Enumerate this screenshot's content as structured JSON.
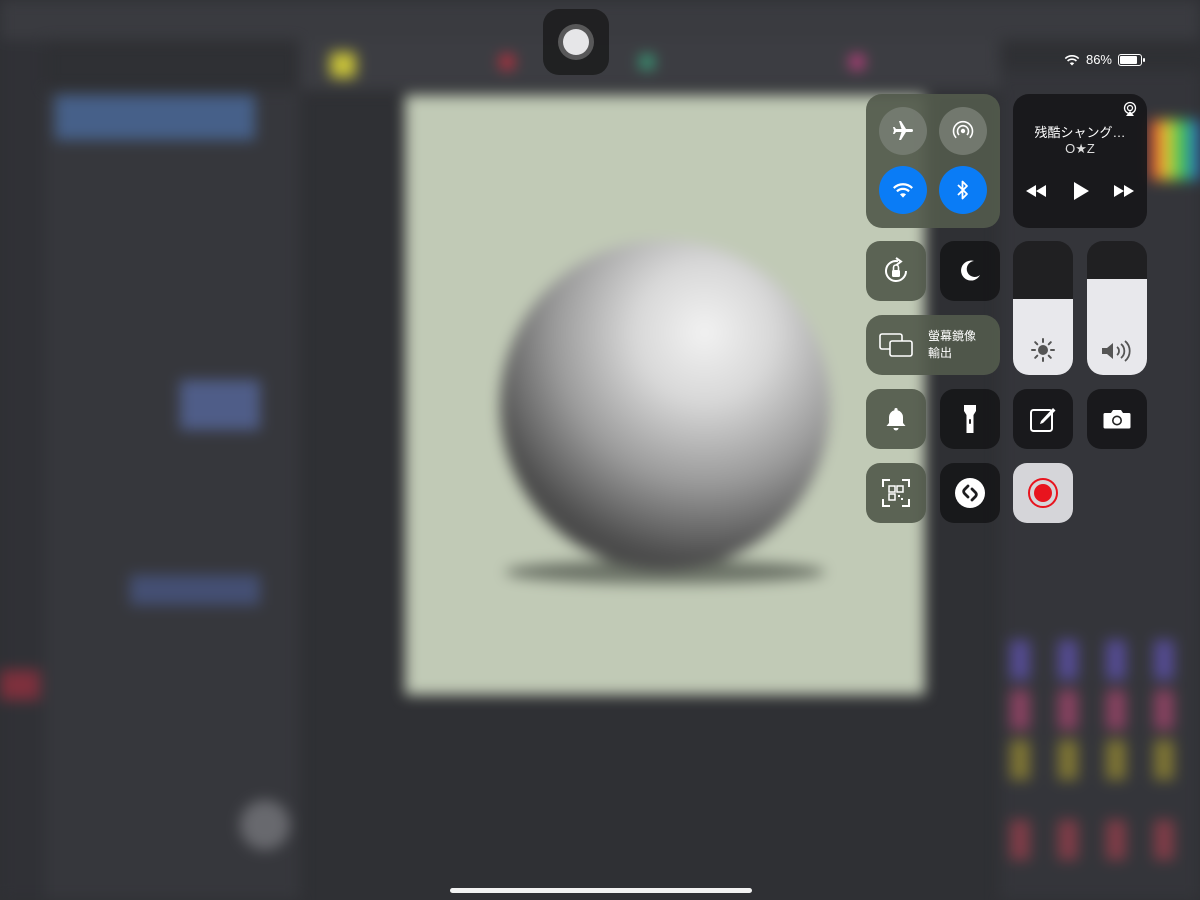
{
  "status_bar": {
    "wifi_icon": "wifi-icon",
    "battery_percent": "86%",
    "battery_level": 0.86
  },
  "colors": {
    "accent_blue": "#0a7cf6",
    "record_red": "#e8141e",
    "canvas_bg": "#c1cab6"
  },
  "control_center": {
    "connectivity": {
      "airplane": {
        "icon": "airplane-icon",
        "active": false
      },
      "airdrop": {
        "icon": "airdrop-icon",
        "active": false
      },
      "wifi": {
        "icon": "wifi-icon",
        "active": true
      },
      "bluetooth": {
        "icon": "bluetooth-icon",
        "active": true
      }
    },
    "now_playing": {
      "title": "残酷シャング…",
      "artist": "O★Z",
      "airplay_icon": "airplay-icon",
      "controls": [
        "rewind-icon",
        "play-icon",
        "fast-forward-icon"
      ]
    },
    "rotation_lock": {
      "icon": "rotation-lock-icon"
    },
    "do_not_disturb": {
      "icon": "moon-icon"
    },
    "screen_mirroring": {
      "label_line1": "螢幕鏡像",
      "label_line2": "輸出",
      "icon": "screen-mirroring-icon"
    },
    "brightness": {
      "level": 0.57,
      "icon": "sun-icon"
    },
    "volume": {
      "level": 0.72,
      "icon": "speaker-icon"
    },
    "shortcuts": [
      "bell-icon",
      "flashlight-icon",
      "notes-icon",
      "camera-icon",
      "qr-scanner-icon",
      "shazam-icon",
      "screen-record-icon"
    ]
  }
}
